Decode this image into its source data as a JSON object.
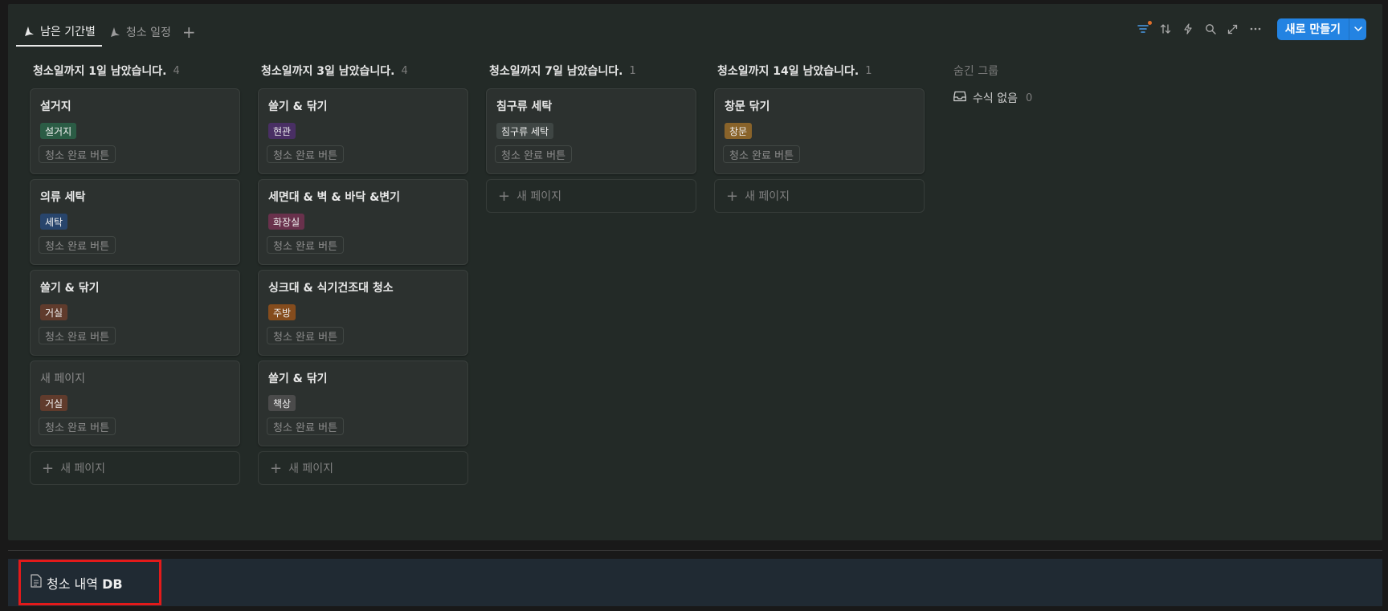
{
  "tabs": [
    {
      "label": "남은 기간별",
      "active": true
    },
    {
      "label": "청소 일정",
      "active": false
    }
  ],
  "toolbar": {
    "new_button_label": "새로 만들기",
    "accent_color": "#2383e2",
    "filter_dot_color": "#e0702c"
  },
  "columns": [
    {
      "title": "청소일까지 1일 남았습니다.",
      "count": "4",
      "cards": [
        {
          "title": "설거지",
          "tag": "설거지",
          "tag_color": "#2b5c45",
          "button": "청소 완료 버튼",
          "placeholder": false
        },
        {
          "title": "의류 세탁",
          "tag": "세탁",
          "tag_color": "#28456c",
          "button": "청소 완료 버튼",
          "placeholder": false
        },
        {
          "title": "쓸기 & 닦기",
          "tag": "거실",
          "tag_color": "#603b2c",
          "button": "청소 완료 버튼",
          "placeholder": false
        },
        {
          "title": "새 페이지",
          "tag": "거실",
          "tag_color": "#603b2c",
          "button": "청소 완료 버튼",
          "placeholder": true
        }
      ],
      "new_page_label": "새 페이지"
    },
    {
      "title": "청소일까지 3일 남았습니다.",
      "count": "4",
      "cards": [
        {
          "title": "쓸기 & 닦기",
          "tag": "현관",
          "tag_color": "#492f64",
          "button": "청소 완료 버튼",
          "placeholder": false
        },
        {
          "title": "세면대 & 벽 & 바닥 &변기",
          "tag": "화장실",
          "tag_color": "#69314c",
          "button": "청소 완료 버튼",
          "placeholder": false
        },
        {
          "title": "싱크대 & 식기건조대 청소",
          "tag": "주방",
          "tag_color": "#854c1d",
          "button": "청소 완료 버튼",
          "placeholder": false
        },
        {
          "title": "쓸기 & 닦기",
          "tag": "책상",
          "tag_color": "#4b4b4b",
          "button": "청소 완료 버튼",
          "placeholder": false
        }
      ],
      "new_page_label": "새 페이지"
    },
    {
      "title": "청소일까지 7일 남았습니다.",
      "count": "1",
      "cards": [
        {
          "title": "침구류 세탁",
          "tag": "침구류 세탁",
          "tag_color": "#3f4644",
          "button": "청소 완료 버튼",
          "placeholder": false
        }
      ],
      "new_page_label": "새 페이지"
    },
    {
      "title": "청소일까지 14일 남았습니다.",
      "count": "1",
      "cards": [
        {
          "title": "창문 닦기",
          "tag": "창문",
          "tag_color": "#89632a",
          "button": "청소 완료 버튼",
          "placeholder": false
        }
      ],
      "new_page_label": "새 페이지"
    }
  ],
  "hidden_groups": {
    "title": "숨긴 그룹",
    "items": [
      {
        "label": "수식 없음",
        "count": "0"
      }
    ]
  },
  "db_link": {
    "label": "청소 내역",
    "suffix": "DB"
  }
}
